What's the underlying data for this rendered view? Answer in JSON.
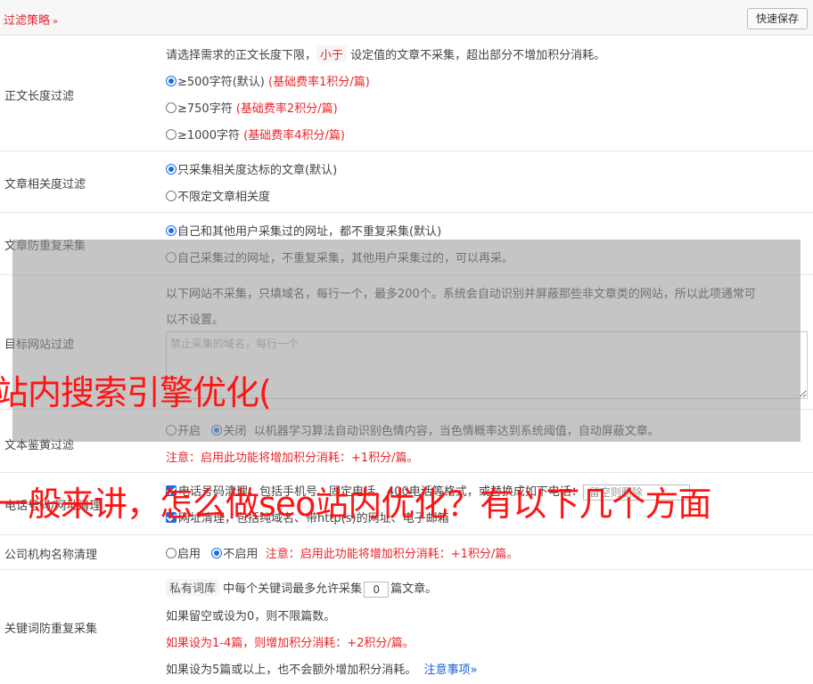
{
  "header": {
    "title": "过滤策略",
    "chevron": "»",
    "save_button": "快速保存"
  },
  "length_filter": {
    "label": "正文长度过滤",
    "desc_pre": "请选择需求的正文长度下限，",
    "desc_tag": "小于",
    "desc_post": "设定值的文章不采集，超出部分不增加积分消耗。",
    "options": [
      {
        "text": "≥500字符(默认)",
        "note": "(基础费率1积分/篇)",
        "checked": true
      },
      {
        "text": "≥750字符",
        "note": "(基础费率2积分/篇)",
        "checked": false
      },
      {
        "text": "≥1000字符",
        "note": "(基础费率4积分/篇)",
        "checked": false
      }
    ]
  },
  "relevance_filter": {
    "label": "文章相关度过滤",
    "options": [
      {
        "text": "只采集相关度达标的文章(默认)",
        "checked": true
      },
      {
        "text": "不限定文章相关度",
        "checked": false
      }
    ]
  },
  "duplicate_filter": {
    "label": "文章防重复采集",
    "options": [
      {
        "text": "自己和其他用户采集过的网址，都不重复采集(默认)",
        "checked": true
      },
      {
        "text": "自己采集过的网址，不重复采集，其他用户采集过的，可以再采。",
        "checked": false
      }
    ]
  },
  "site_filter": {
    "label": "目标网站过滤",
    "desc_line1": "以下网站不采集，只填域名，每行一个，最多200个。系统会自动识别并屏蔽那些非文章类的网站，所以此项通常可",
    "desc_line2": "以不设置。",
    "placeholder": "禁止采集的域名，每行一个"
  },
  "text_review": {
    "label": "文本鉴黄过滤",
    "opt_on": "开启",
    "opt_off": "关闭",
    "desc": "以机器学习算法自动识别色情内容，当色情概率达到系统阈值，自动屏蔽文章。",
    "note": "注意：启用此功能将增加积分消耗：+1积分/篇。"
  },
  "phone_cleanup": {
    "label": "电话号码/网址清理",
    "line1_part1": "电话号码清理，",
    "line1_part2": "包括手机号、固定电话、400电话等格式，或替换成如下电话：",
    "phone_placeholder": "留空则删除",
    "line2": "网址清理，包括纯域名、带http(s)的网址、电子邮箱"
  },
  "org_cleanup": {
    "label": "公司机构名称清理",
    "opt_on": "启用",
    "opt_off": "不启用",
    "note": "注意：启用此功能将增加积分消耗：+1积分/篇。"
  },
  "keyword_dedup": {
    "label": "关键词防重复采集",
    "tag": "私有词库",
    "line1_pre": "中每个关键词最多允许采集",
    "value": "0",
    "line1_post": "篇文章。",
    "line2": "如果留空或设为0，则不限篇数。",
    "line3": "如果设为1-4篇，则增加积分消耗：+2积分/篇。",
    "line4": "如果设为5篇或以上，也不会额外增加积分消耗。",
    "link": "注意事项",
    "link_chevron": "»"
  },
  "watermarks": {
    "line1": "站内搜索引擎优化(",
    "line2": "一般来讲，怎么做seo站内优化？有以下几个方面"
  },
  "colors": {
    "accent_red": "#e8262a",
    "link_blue": "#1a5fd6",
    "radio_blue": "#1a6fe0"
  }
}
